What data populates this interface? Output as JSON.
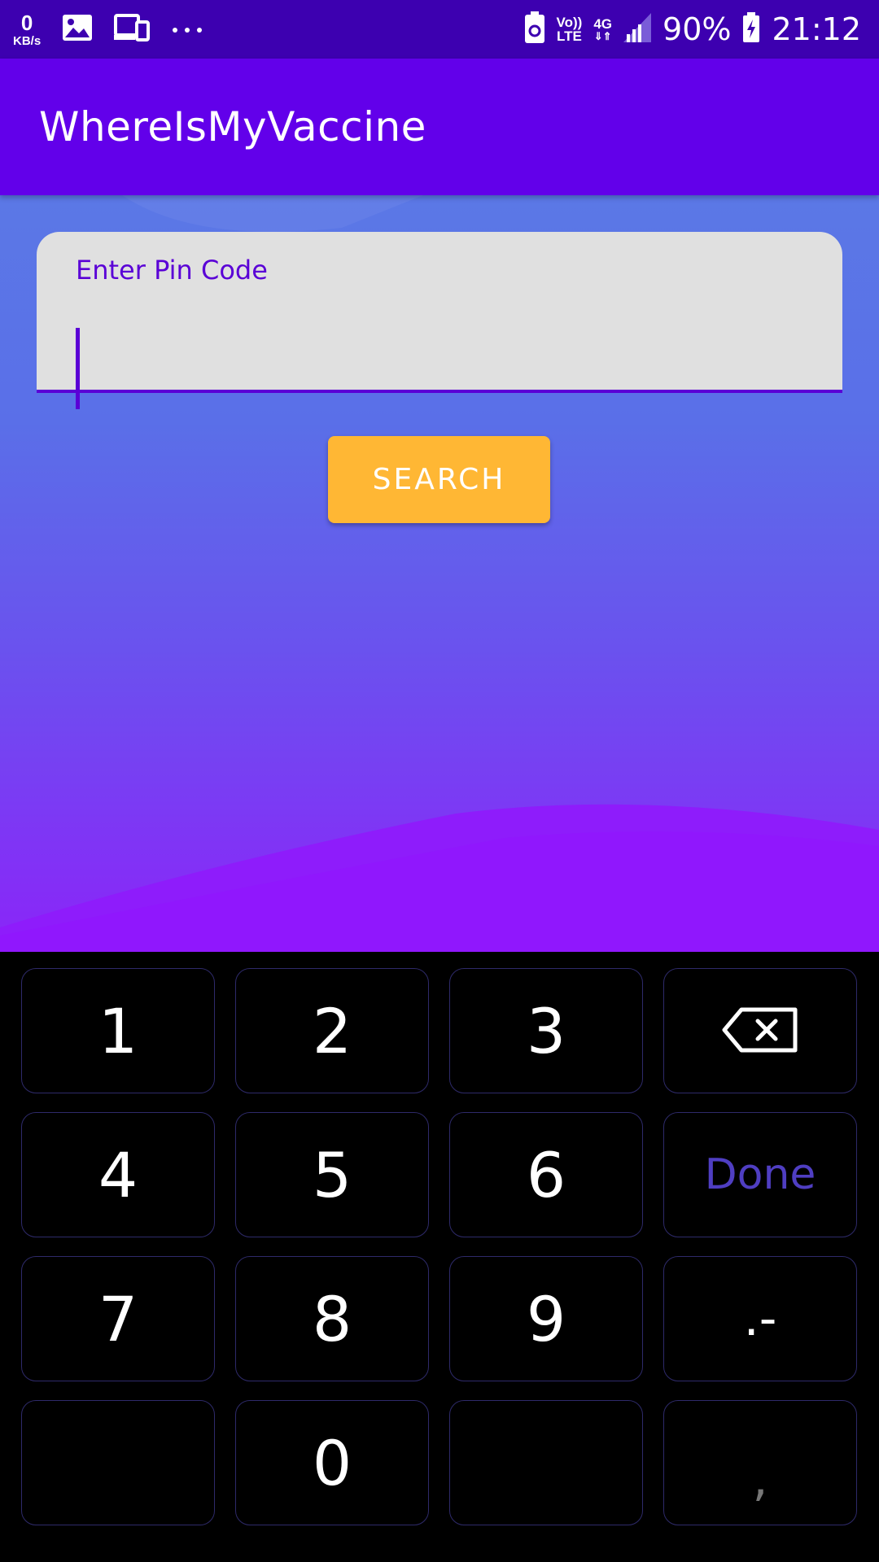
{
  "status_bar": {
    "net_speed_value": "0",
    "net_speed_unit": "KB/s",
    "volte_top": "Vo))",
    "volte_bottom": "LTE",
    "network_type": "4G",
    "battery_percent": "90%",
    "time": "21:12",
    "icons": [
      "gallery-icon",
      "devices-icon",
      "more-dots-icon",
      "battery-saver-icon",
      "signal-icon",
      "battery-icon"
    ]
  },
  "app_bar": {
    "title": "WhereIsMyVaccine"
  },
  "form": {
    "pin_label": "Enter Pin Code",
    "pin_value": "",
    "search_label": "SEARCH"
  },
  "keyboard": {
    "rows": [
      [
        "1",
        "2",
        "3",
        "backspace"
      ],
      [
        "4",
        "5",
        "6",
        "Done"
      ],
      [
        "7",
        "8",
        "9",
        ".-"
      ],
      [
        "",
        "0",
        "",
        ","
      ]
    ],
    "k1": "1",
    "k2": "2",
    "k3": "3",
    "k4": "4",
    "k5": "5",
    "k6": "6",
    "done": "Done",
    "k7": "7",
    "k8": "8",
    "k9": "9",
    "dot_dash": ".-",
    "k0": "0",
    "comma": ","
  },
  "colors": {
    "status_bar": "#3d00b0",
    "app_bar": "#6200ea",
    "accent": "#5a00d6",
    "button": "#ffb734",
    "keyboard_bg": "#000000",
    "key_border": "#2e2a6a",
    "done_text": "#4f3ec2"
  }
}
